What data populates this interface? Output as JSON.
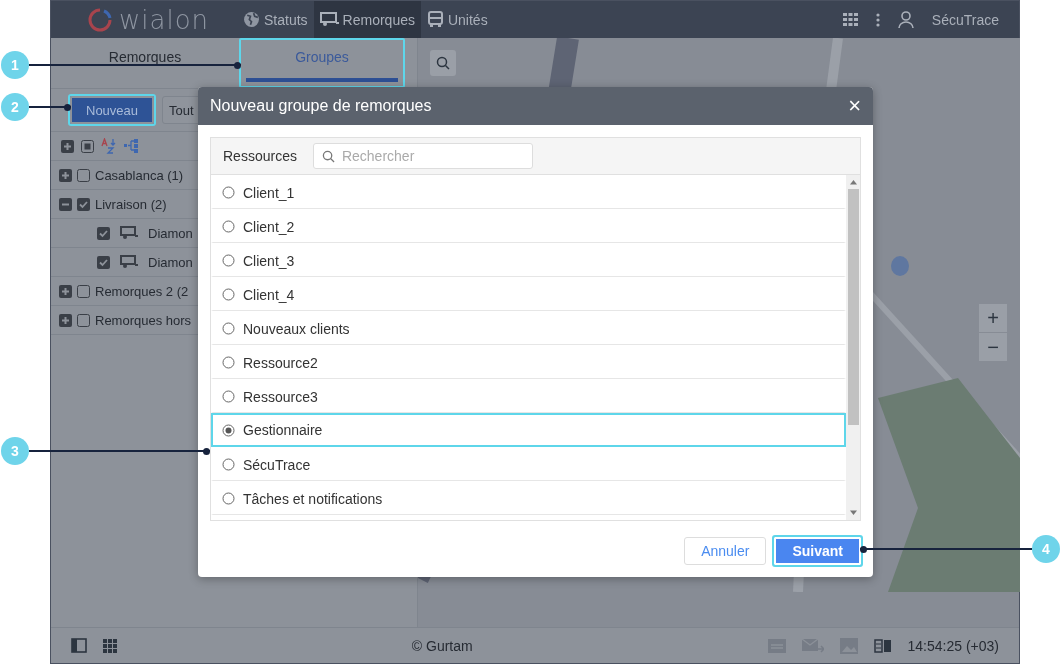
{
  "header": {
    "logo": "wialon",
    "nav": [
      {
        "label": "Statuts",
        "selected": false
      },
      {
        "label": "Remorques",
        "selected": true
      },
      {
        "label": "Unités",
        "selected": false
      }
    ],
    "user": "SécuTrace"
  },
  "left_panel": {
    "tabs": [
      {
        "label": "Remorques",
        "selected": false,
        "highlighted": false
      },
      {
        "label": "Groupes",
        "selected": true,
        "highlighted": true
      }
    ],
    "new_button": {
      "label": "Nouveau",
      "highlighted": true
    },
    "filter_button": "Tout",
    "groups": [
      {
        "name": "Casablanca (1)",
        "expanded": false,
        "checked": false
      },
      {
        "name": "Livraison (2)",
        "expanded": true,
        "checked": true,
        "children": [
          {
            "name": "Diamon",
            "checked": true
          },
          {
            "name": "Diamon",
            "checked": true
          }
        ]
      },
      {
        "name": "Remorques 2 (2",
        "expanded": false,
        "checked": false
      },
      {
        "name": "Remorques hors",
        "expanded": false,
        "checked": false
      }
    ]
  },
  "map": {
    "zoom_in": "+",
    "zoom_out": "−"
  },
  "dialog": {
    "title": "Nouveau groupe de remorques",
    "close": "×",
    "resources_label": "Ressources",
    "search": {
      "placeholder": "Rechercher"
    },
    "items": [
      {
        "name": "Client_1",
        "selected": false,
        "highlighted": false
      },
      {
        "name": "Client_2",
        "selected": false,
        "highlighted": false
      },
      {
        "name": "Client_3",
        "selected": false,
        "highlighted": false
      },
      {
        "name": "Client_4",
        "selected": false,
        "highlighted": false
      },
      {
        "name": "Nouveaux clients",
        "selected": false,
        "highlighted": false
      },
      {
        "name": "Ressource2",
        "selected": false,
        "highlighted": false
      },
      {
        "name": "Ressource3",
        "selected": false,
        "highlighted": false
      },
      {
        "name": "Gestionnaire",
        "selected": true,
        "highlighted": true
      },
      {
        "name": "SécuTrace",
        "selected": false,
        "highlighted": false
      },
      {
        "name": "Tâches et notifications",
        "selected": false,
        "highlighted": false
      }
    ],
    "cancel": "Annuler",
    "next": {
      "label": "Suivant",
      "highlighted": true
    }
  },
  "status_bar": {
    "copyright": "© Gurtam",
    "time": "14:54:25 (+03)"
  },
  "callouts": [
    {
      "number": "1"
    },
    {
      "number": "2"
    },
    {
      "number": "3"
    },
    {
      "number": "4"
    }
  ]
}
